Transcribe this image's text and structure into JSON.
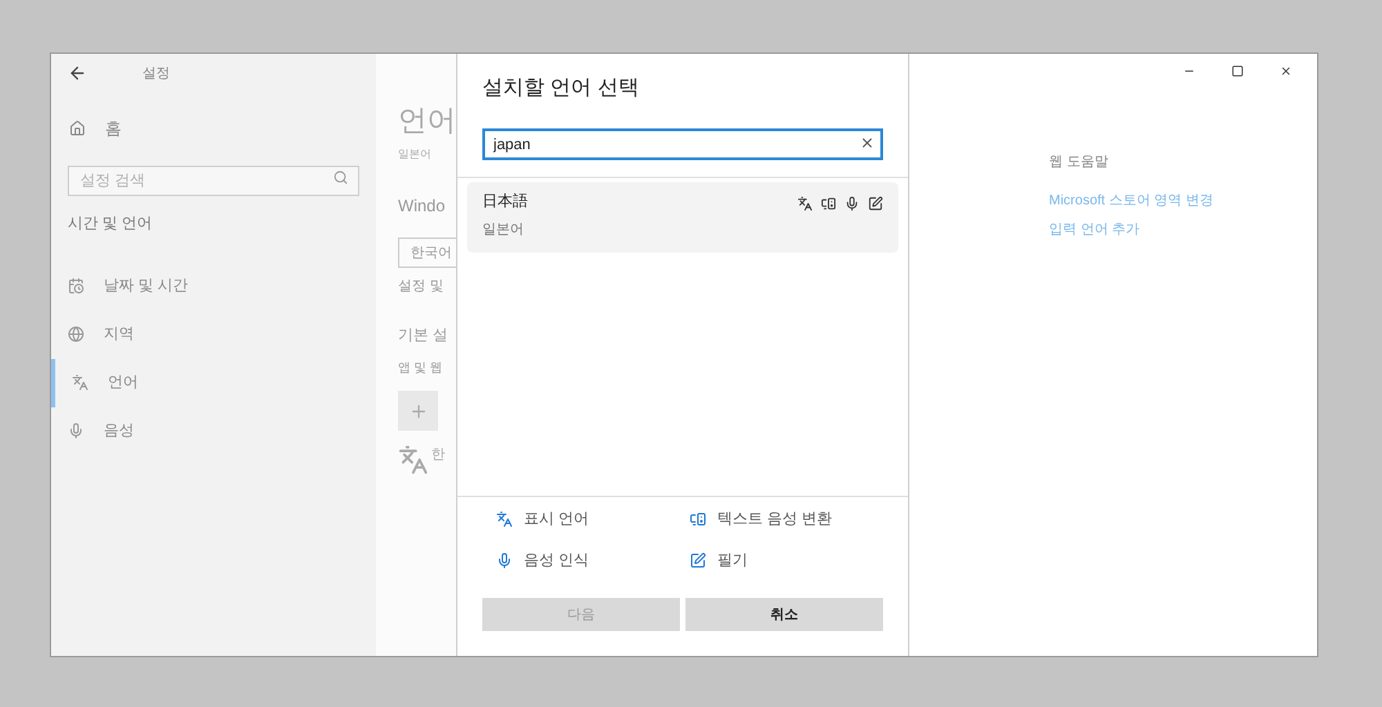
{
  "window": {
    "title": "설정"
  },
  "sidebar": {
    "home": "홈",
    "search": {
      "placeholder": "설정 검색"
    },
    "section": "시간 및 언어",
    "items": [
      {
        "kind": "datetime",
        "label": "날짜 및 시간",
        "selected": false
      },
      {
        "kind": "region",
        "label": "지역",
        "selected": false
      },
      {
        "kind": "language",
        "label": "언어",
        "selected": true
      },
      {
        "kind": "speech",
        "label": "음성",
        "selected": false
      }
    ]
  },
  "main": {
    "title": "언어",
    "subtitle": "일본어",
    "section_1": "Windo",
    "dropdown": "한국어",
    "note": "설정 및",
    "section_2": "기본 설",
    "caption": "앱 및 웹",
    "add_icon_label": "한"
  },
  "dialog": {
    "title": "설치할 언어 선택",
    "search": {
      "value": "japan"
    },
    "results": [
      {
        "name": "日本語",
        "subtitle": "일본어",
        "selected": true,
        "features": [
          {
            "kind": "display"
          },
          {
            "kind": "tts"
          },
          {
            "kind": "speech"
          },
          {
            "kind": "handwriting"
          }
        ]
      }
    ],
    "legend": [
      {
        "kind": "display",
        "label": "표시 언어"
      },
      {
        "kind": "tts",
        "label": "텍스트 음성 변환"
      },
      {
        "kind": "speech",
        "label": "음성 인식"
      },
      {
        "kind": "handwriting",
        "label": "필기"
      }
    ],
    "buttons": [
      {
        "label": "다음",
        "disabled": true
      },
      {
        "label": "취소",
        "disabled": false
      }
    ]
  },
  "help": {
    "title": "웹 도움말",
    "links": [
      "Microsoft 스토어 영역 변경",
      "입력 언어 추가"
    ]
  }
}
